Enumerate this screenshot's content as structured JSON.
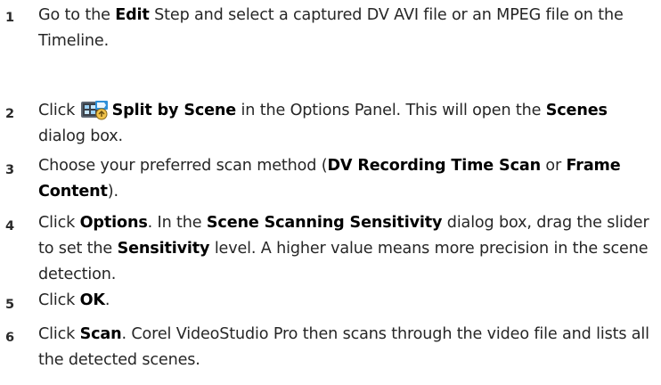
{
  "steps": [
    {
      "number": "1",
      "parts": [
        {
          "t": "Go to the "
        },
        {
          "b": "Edit"
        },
        {
          "t": " Step and select a captured DV AVI file or an MPEG file on the Timeline."
        }
      ]
    },
    {
      "number": "2",
      "icon": "split-by-scene-icon",
      "parts": [
        {
          "t": "Click "
        },
        {
          "icon": true
        },
        {
          "b": "Split by Scene"
        },
        {
          "t": " in the Options Panel. This will open the "
        },
        {
          "b": "Scenes"
        },
        {
          "t": " dialog box."
        }
      ]
    },
    {
      "number": "3",
      "parts": [
        {
          "t": "Choose your preferred scan method ("
        },
        {
          "b": "DV Recording Time Scan"
        },
        {
          "t": " or "
        },
        {
          "b": "Frame Content"
        },
        {
          "t": ")."
        }
      ]
    },
    {
      "number": "4",
      "parts": [
        {
          "t": "Click "
        },
        {
          "b": "Options"
        },
        {
          "t": ". In the "
        },
        {
          "b": "Scene Scanning Sensitivity"
        },
        {
          "t": " dialog box, drag the slider to set the "
        },
        {
          "b": "Sensitivity"
        },
        {
          "t": " level. A higher value means more precision in the scene detection."
        }
      ]
    },
    {
      "number": "5",
      "parts": [
        {
          "t": "Click "
        },
        {
          "b": "OK"
        },
        {
          "t": "."
        }
      ]
    },
    {
      "number": "6",
      "parts": [
        {
          "t": "Click "
        },
        {
          "b": "Scan"
        },
        {
          "t": ". Corel VideoStudio Pro then scans through the video file and lists all the detected scenes."
        }
      ]
    }
  ]
}
